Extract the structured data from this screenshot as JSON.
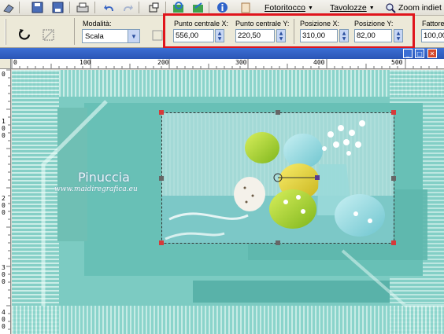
{
  "top_toolbar": {
    "icons": [
      "paint-icon",
      "save-icon",
      "save-as-icon",
      "print-icon",
      "undo-icon",
      "redo-icon",
      "crop-icon",
      "refresh-icon",
      "export-icon",
      "info-icon",
      "script-icon"
    ],
    "menus": [
      {
        "label": "Fotoritocco",
        "arrow": "▼"
      },
      {
        "label": "Tavolozze",
        "arrow": "▼"
      },
      {
        "label": "Zoom indiet"
      }
    ]
  },
  "options_bar": {
    "mode_label": "Modalità:",
    "mode_value": "Scala",
    "center_x_label": "Punto centrale X:",
    "center_x_value": "556,00",
    "center_y_label": "Punto centrale Y:",
    "center_y_value": "220,50",
    "pos_x_label": "Posizione X:",
    "pos_x_value": "310,00",
    "pos_y_label": "Posizione Y:",
    "pos_y_value": "82,00",
    "factor_label": "Fattore",
    "factor_value": "100,00"
  },
  "rulers": {
    "horizontal": [
      "0",
      "100",
      "200",
      "300",
      "400",
      "500"
    ],
    "vertical": [
      "0",
      "100",
      "200",
      "300",
      "400",
      "500"
    ]
  },
  "watermark": {
    "name": "Pinuccia",
    "url": "www.maidiregrafica.eu"
  },
  "colors": {
    "highlight": "#e0151c",
    "canvas_teal": "#6fc7bf",
    "handle": "#d63a3a"
  }
}
